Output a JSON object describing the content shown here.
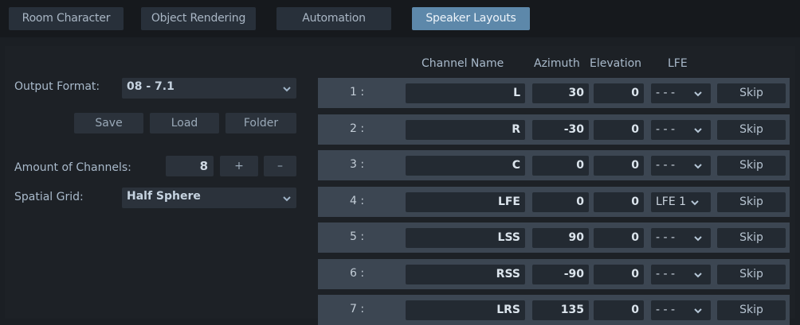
{
  "tabs": [
    {
      "label": "Room Character"
    },
    {
      "label": "Object Rendering"
    },
    {
      "label": "Automation"
    },
    {
      "label": "Speaker Layouts"
    }
  ],
  "active_tab": "Speaker Layouts",
  "left": {
    "output_format_label": "Output Format:",
    "output_format_value": "08 - 7.1",
    "save_label": "Save",
    "load_label": "Load",
    "folder_label": "Folder",
    "channels_label": "Amount of Channels:",
    "channels_value": "8",
    "plus_label": "+",
    "minus_label": "–",
    "grid_label": "Spatial Grid:",
    "grid_value": "Half Sphere"
  },
  "table": {
    "headers": {
      "channel_name": "Channel Name",
      "azimuth": "Azimuth",
      "elevation": "Elevation",
      "lfe": "LFE"
    },
    "rows": [
      {
        "num": "1 :",
        "name": "L",
        "azimuth": "30",
        "elevation": "0",
        "lfe": "- - -",
        "skip": "Skip"
      },
      {
        "num": "2 :",
        "name": "R",
        "azimuth": "-30",
        "elevation": "0",
        "lfe": "- - -",
        "skip": "Skip"
      },
      {
        "num": "3 :",
        "name": "C",
        "azimuth": "0",
        "elevation": "0",
        "lfe": "- - -",
        "skip": "Skip"
      },
      {
        "num": "4 :",
        "name": "LFE",
        "azimuth": "0",
        "elevation": "0",
        "lfe": "LFE 1",
        "skip": "Skip"
      },
      {
        "num": "5 :",
        "name": "LSS",
        "azimuth": "90",
        "elevation": "0",
        "lfe": "- - -",
        "skip": "Skip"
      },
      {
        "num": "6 :",
        "name": "RSS",
        "azimuth": "-90",
        "elevation": "0",
        "lfe": "- - -",
        "skip": "Skip"
      },
      {
        "num": "7 :",
        "name": "LRS",
        "azimuth": "135",
        "elevation": "0",
        "lfe": "- - -",
        "skip": "Skip"
      }
    ]
  },
  "colors": {
    "background": "#1b1f24",
    "active_tab": "#5d88aa",
    "row": "#3c4652",
    "field": "#232a32"
  }
}
